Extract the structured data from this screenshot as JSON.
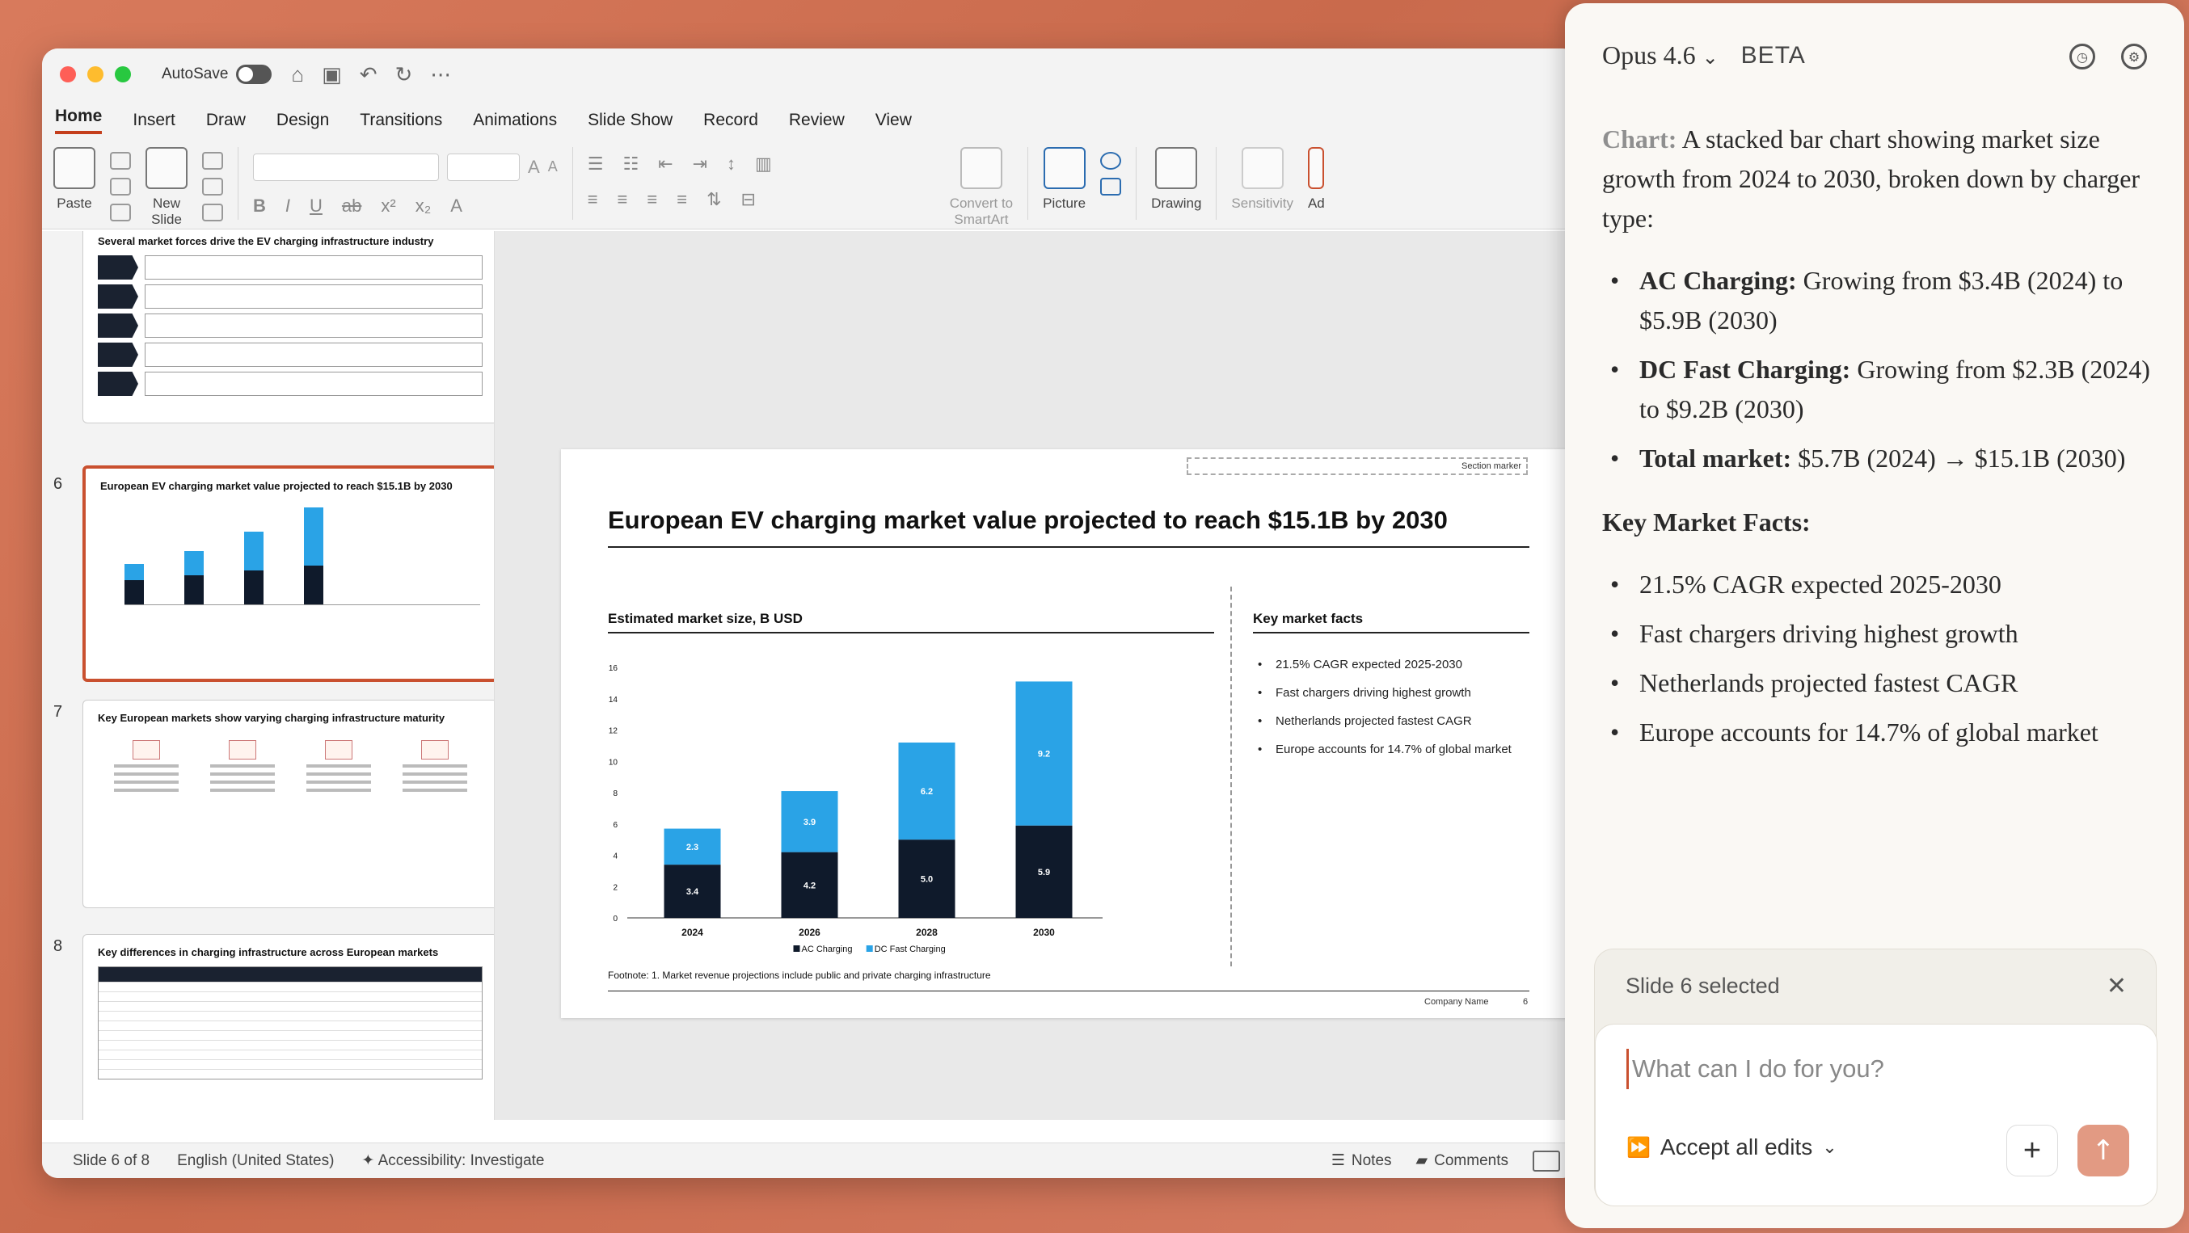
{
  "titlebar": {
    "autosave_label": "AutoSave"
  },
  "menu": {
    "tabs": [
      "Home",
      "Insert",
      "Draw",
      "Design",
      "Transitions",
      "Animations",
      "Slide Show",
      "Record",
      "Review",
      "View"
    ],
    "active": "Home"
  },
  "ribbon": {
    "paste": "Paste",
    "new_slide_1": "New",
    "new_slide_2": "Slide",
    "convert_1": "Convert to",
    "convert_2": "SmartArt",
    "picture": "Picture",
    "drawing": "Drawing",
    "sensitivity": "Sensitivity",
    "addins": "Ad"
  },
  "thumbnails": {
    "t5_title": "Several market forces drive the EV charging infrastructure industry",
    "t6_num": "6",
    "t6_title": "European EV charging market value projected to reach $15.1B by 2030",
    "t7_num": "7",
    "t7_title": "Key European markets show varying charging infrastructure maturity",
    "t8_num": "8",
    "t8_title": "Key differences in charging infrastructure across European markets"
  },
  "slide": {
    "section_marker": "Section marker",
    "title": "European EV charging market value projected to reach $15.1B by 2030",
    "chart_title": "Estimated market size, B USD",
    "facts_title": "Key market facts",
    "facts": [
      "21.5% CAGR expected 2025-2030",
      "Fast chargers driving highest growth",
      "Netherlands projected fastest CAGR",
      "Europe accounts for 14.7% of global market"
    ],
    "footnote": "Footnote: 1. Market revenue projections include public and private charging infrastructure",
    "company": "Company Name",
    "page": "6"
  },
  "chart_data": {
    "type": "bar",
    "stacked": true,
    "categories": [
      "2024",
      "2026",
      "2028",
      "2030"
    ],
    "series": [
      {
        "name": "AC Charging",
        "values": [
          3.4,
          4.2,
          5.0,
          5.9
        ],
        "color": "#0f1a2b"
      },
      {
        "name": "DC Fast Charging",
        "values": [
          2.3,
          3.9,
          6.2,
          9.2
        ],
        "color": "#2aa3e6"
      }
    ],
    "yticks": [
      "0",
      "2",
      "4",
      "6",
      "8",
      "10",
      "12",
      "14",
      "16"
    ],
    "ylim": [
      0,
      16
    ],
    "legend_position": "bottom",
    "grid": false
  },
  "status": {
    "slide_of": "Slide 6 of 8",
    "language": "English (United States)",
    "accessibility": "Accessibility: Investigate",
    "notes": "Notes",
    "comments": "Comments"
  },
  "panel": {
    "model": "Opus 4.6",
    "beta": "BETA",
    "chart_label": "Chart:",
    "chart_intro": "A stacked bar chart showing market size growth from 2024 to 2030, broken down by charger type:",
    "bullets": [
      {
        "bold": "AC Charging:",
        "text": "Growing from $3.4B (2024) to $5.9B (2030)"
      },
      {
        "bold": "DC Fast Charging:",
        "text": "Growing from $2.3B (2024) to $9.2B (2030)"
      },
      {
        "bold": "Total market:",
        "text": "$5.7B (2024) → $15.1B (2030)"
      }
    ],
    "facts_heading": "Key Market Facts:",
    "facts": [
      "21.5% CAGR expected 2025-2030",
      "Fast chargers driving highest growth",
      "Netherlands projected fastest CAGR",
      "Europe accounts for 14.7% of global market"
    ],
    "selection_label": "Slide 6 selected",
    "input_placeholder": "What can I do for you?",
    "accept_label": "Accept all edits"
  },
  "colors": {
    "accent": "#c9502f",
    "ac_charging": "#0f1a2b",
    "dc_fast": "#2aa3e6",
    "send_button": "#e29a83"
  }
}
